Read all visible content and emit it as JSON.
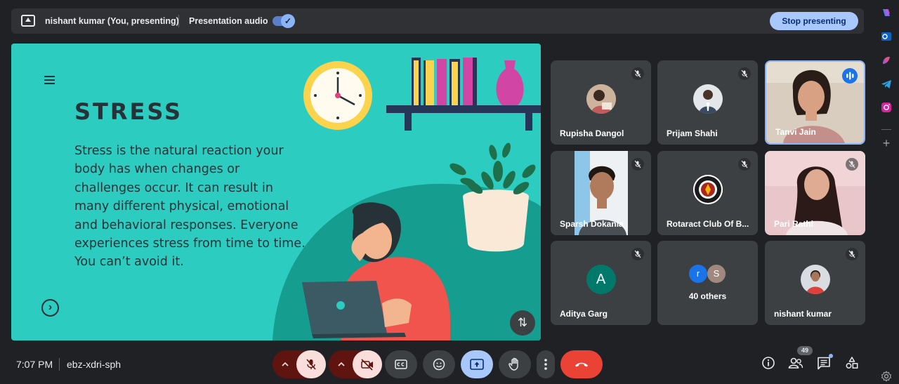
{
  "presenting_bar": {
    "name": "nishant kumar (You, presenting)",
    "audio_label": "Presentation audio",
    "audio_on": true,
    "stop_label": "Stop presenting"
  },
  "slide": {
    "title": "STRESS",
    "body": "Stress is the natural reaction your body has when changes or challenges occur. It can result in many different physical, emotional and behavioral responses. Everyone experiences stress from time to time. You can’t avoid it.",
    "next_glyph": "›",
    "colors": {
      "background": "#2ccdc0",
      "dark_teal": "#159d90",
      "text": "#263238"
    }
  },
  "participants": [
    {
      "name": "Rupisha Dangol",
      "muted": true,
      "display": "avatar-photo"
    },
    {
      "name": "Prijam Shahi",
      "muted": true,
      "display": "avatar-photo"
    },
    {
      "name": "Tanvi Jain",
      "muted": false,
      "speaking": true,
      "display": "camera"
    },
    {
      "name": "Sparsh Dokania",
      "muted": true,
      "display": "camera"
    },
    {
      "name": "Rotaract Club Of B...",
      "muted": true,
      "display": "avatar-logo"
    },
    {
      "name": "Pari Rathi",
      "muted": true,
      "display": "camera"
    },
    {
      "name": "Aditya Garg",
      "muted": true,
      "display": "avatar-letter",
      "initial": "A",
      "color": "#00796b"
    },
    {
      "name": "40 others",
      "muted": false,
      "display": "group",
      "initials": [
        "r",
        "S"
      ]
    },
    {
      "name": "nishant kumar",
      "muted": true,
      "display": "avatar-photo"
    }
  ],
  "bottom_bar": {
    "time": "7:07 PM",
    "meeting_code": "ebz-xdri-sph",
    "people_count": "49",
    "controls": [
      "mic-options-icon",
      "mic-off-icon",
      "camera-options-icon",
      "camera-off-icon",
      "captions-icon",
      "emoji-icon",
      "present-icon",
      "raise-hand-icon",
      "more-options-icon",
      "end-call-icon"
    ],
    "colors": {
      "danger": "#f9dedc",
      "danger_dark": "#601410",
      "end_call": "#ea4335",
      "present_active": "#a8c7fa",
      "neutral": "#3c4043"
    }
  }
}
